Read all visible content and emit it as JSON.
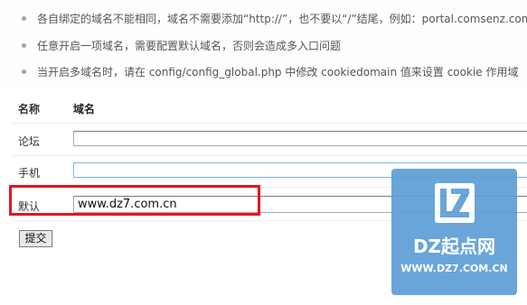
{
  "tips": [
    "各自绑定的域名不能相同，域名不需要添加“http://”，也不要以“/”结尾，例如：portal.comsenz.com",
    "任意开启一项域名，需要配置默认域名，否则会造成多入口问题",
    "当开启多域名时，请在 config/config_global.php 中修改 cookiedomain 值来设置 cookie 作用域"
  ],
  "table": {
    "header": {
      "name": "名称",
      "domain": "域名"
    },
    "rows": [
      {
        "label": "论坛",
        "value": ""
      },
      {
        "label": "手机",
        "value": ""
      },
      {
        "label": "默认",
        "value": "www.dz7.com.cn"
      }
    ]
  },
  "submit_label": "提交",
  "watermark": {
    "title": "DZ起点网",
    "url": "WWW.DZ7.COM.CN",
    "logo_letters": "LZ"
  },
  "colors": {
    "highlight_border": "#e8141c",
    "watermark_bg": "#5e9ed6",
    "focus_border": "#7eb4ea"
  }
}
